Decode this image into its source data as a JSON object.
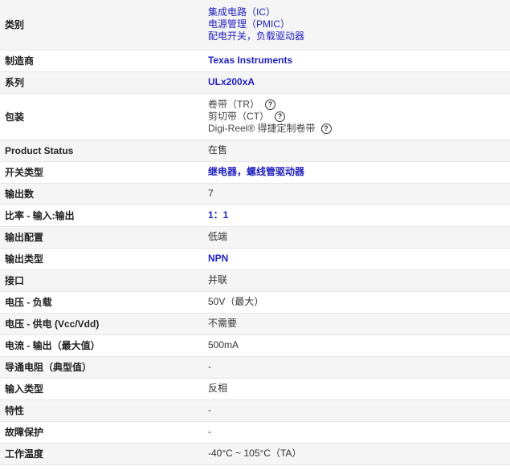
{
  "rows": [
    {
      "label": "类别",
      "type": "links",
      "values": [
        "集成电路（IC）",
        "电源管理（PMIC）",
        "配电开关，负载驱动器"
      ]
    },
    {
      "label": "制造商",
      "type": "link",
      "value": "Texas Instruments"
    },
    {
      "label": "系列",
      "type": "link",
      "value": "ULx200xA"
    },
    {
      "label": "包装",
      "type": "packaging",
      "values": [
        "卷带（TR）",
        "剪切带（CT）",
        "Digi-Reel® 得捷定制卷带"
      ],
      "icon": "question-circle-icon"
    },
    {
      "label": "Product Status",
      "type": "text",
      "value": "在售"
    },
    {
      "label": "开关类型",
      "type": "link",
      "value": "继电器，螺线管驱动器"
    },
    {
      "label": "输出数",
      "type": "text",
      "value": "7"
    },
    {
      "label": "比率 - 输入:输出",
      "type": "link",
      "value": "1：1"
    },
    {
      "label": "输出配置",
      "type": "text",
      "value": "低端"
    },
    {
      "label": "输出类型",
      "type": "link",
      "value": "NPN"
    },
    {
      "label": "接口",
      "type": "text",
      "value": "并联"
    },
    {
      "label": "电压 - 负载",
      "type": "text",
      "value": "50V（最大）"
    },
    {
      "label": "电压 - 供电 (Vcc/Vdd)",
      "type": "text",
      "value": "不需要"
    },
    {
      "label": "电流 - 输出（最大值）",
      "type": "text",
      "value": "500mA"
    },
    {
      "label": "导通电阻（典型值）",
      "type": "text",
      "value": "-"
    },
    {
      "label": "输入类型",
      "type": "text",
      "value": "反相"
    },
    {
      "label": "特性",
      "type": "text",
      "value": "-"
    },
    {
      "label": "故障保护",
      "type": "text",
      "value": "-"
    },
    {
      "label": "工作温度",
      "type": "text",
      "value": "-40°C ~ 105°C（TA）"
    }
  ]
}
